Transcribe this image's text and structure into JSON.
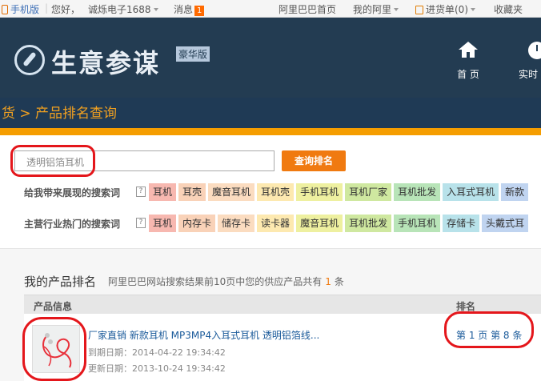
{
  "topbar": {
    "mobile_label": "手机版",
    "greeting": "您好，",
    "username": "诚烁电子1688",
    "messages_label": "消息",
    "messages_count": "1",
    "home_link": "阿里巴巴首页",
    "my_alibaba": "我的阿里",
    "cart_label": "进货单(0)",
    "favorites": "收藏夹"
  },
  "header": {
    "logo_text": "生意参谋",
    "edition": "豪华版",
    "nav": [
      {
        "label": "首 页",
        "icon": "home-icon"
      },
      {
        "label": "实时",
        "icon": "clock-icon"
      }
    ]
  },
  "breadcrumb": "货 > 产品排名查询",
  "search": {
    "value": "透明铝箔耳机",
    "button_label": "查询排名"
  },
  "keyword_rows": [
    {
      "label": "给我带来展现的搜索词",
      "help": "?",
      "tags": [
        {
          "text": "耳机",
          "bg": "#f7b8b0"
        },
        {
          "text": "耳壳",
          "bg": "#f9d2b8"
        },
        {
          "text": "魔音耳机",
          "bg": "#fbdcc0"
        },
        {
          "text": "耳机壳",
          "bg": "#fde9b0"
        },
        {
          "text": "手机耳机",
          "bg": "#eef0a0"
        },
        {
          "text": "耳机厂家",
          "bg": "#cfe8a0"
        },
        {
          "text": "耳机批发",
          "bg": "#b8e4b8"
        },
        {
          "text": "入耳式耳机",
          "bg": "#b8e2ea"
        },
        {
          "text": "新款",
          "bg": "#c0d4f0"
        }
      ]
    },
    {
      "label": "主营行业热门的搜索词",
      "help": "?",
      "tags": [
        {
          "text": "耳机",
          "bg": "#f7b8b0"
        },
        {
          "text": "内存卡",
          "bg": "#f9d2b8"
        },
        {
          "text": "储存卡",
          "bg": "#fbdcc0"
        },
        {
          "text": "读卡器",
          "bg": "#fde9b0"
        },
        {
          "text": "魔音耳机",
          "bg": "#eef0a0"
        },
        {
          "text": "耳机批发",
          "bg": "#cfe8a0"
        },
        {
          "text": "手机耳机",
          "bg": "#b8e4b8"
        },
        {
          "text": "存储卡",
          "bg": "#b8e2ea"
        },
        {
          "text": "头戴式耳",
          "bg": "#c0d4f0"
        }
      ]
    }
  ],
  "ranking": {
    "title": "我的产品排名",
    "desc_prefix": "阿里巴巴网站搜索结果前10页中您的供应产品共有",
    "count": "1",
    "desc_suffix": "条",
    "col_product": "产品信息",
    "col_rank": "排名",
    "rows": [
      {
        "title": "厂家直销  新款耳机  MP3MP4入耳式耳机  透明铝箔线...",
        "expire": "到期日期：2014-04-22 19:34:42",
        "updated": "更新日期：2013-10-24 19:34:42",
        "rank": "第 1 页 第 8 条"
      }
    ]
  },
  "colors": {
    "header_bg": "#233c52",
    "accent": "#f59d00",
    "button": "#f07a10",
    "annotation": "#e4161b"
  }
}
